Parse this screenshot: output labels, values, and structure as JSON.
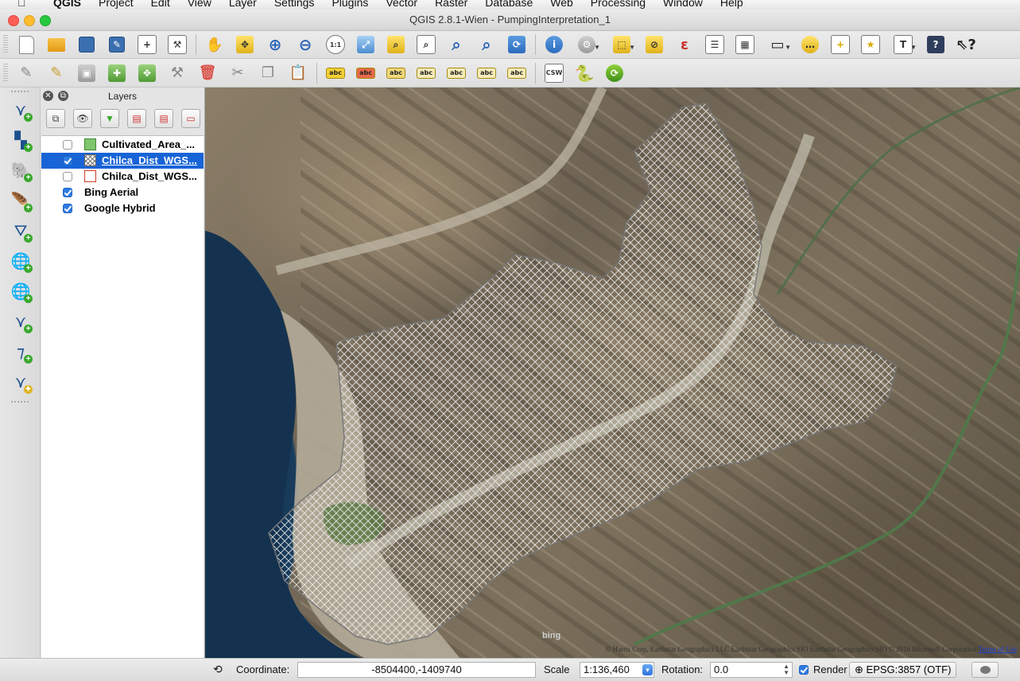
{
  "menubar": {
    "items": [
      "QGIS",
      "Project",
      "Edit",
      "View",
      "Layer",
      "Settings",
      "Plugins",
      "Vector",
      "Raster",
      "Database",
      "Web",
      "Processing",
      "Window",
      "Help"
    ]
  },
  "window": {
    "title": "QGIS 2.8.1-Wien - PumpingInterpretation_1"
  },
  "toolbar1": {
    "buttons": [
      {
        "name": "new-project-icon"
      },
      {
        "name": "open-project-icon"
      },
      {
        "name": "save-project-icon"
      },
      {
        "name": "save-as-icon"
      },
      {
        "name": "new-print-composer-icon"
      },
      {
        "name": "composer-manager-icon"
      },
      {
        "name": "pan-icon"
      },
      {
        "name": "pan-to-selection-icon"
      },
      {
        "name": "zoom-in-icon"
      },
      {
        "name": "zoom-out-icon"
      },
      {
        "name": "zoom-native-icon"
      },
      {
        "name": "zoom-full-icon"
      },
      {
        "name": "zoom-to-selection-icon"
      },
      {
        "name": "zoom-to-layer-icon"
      },
      {
        "name": "zoom-last-icon"
      },
      {
        "name": "zoom-next-icon"
      },
      {
        "name": "refresh-icon"
      },
      {
        "name": "identify-icon"
      },
      {
        "name": "run-action-icon"
      },
      {
        "name": "select-features-icon"
      },
      {
        "name": "deselect-icon"
      },
      {
        "name": "field-calculator-icon"
      },
      {
        "name": "select-by-expression-icon"
      },
      {
        "name": "attribute-table-icon"
      },
      {
        "name": "statistics-icon"
      },
      {
        "name": "measure-icon"
      },
      {
        "name": "map-tips-icon"
      },
      {
        "name": "new-bookmark-icon"
      },
      {
        "name": "show-bookmarks-icon"
      },
      {
        "name": "text-annotation-icon"
      },
      {
        "name": "help-icon"
      },
      {
        "name": "whats-this-icon"
      }
    ],
    "zoom_native_text": "1:1",
    "epsilon_text": "ε",
    "text_tool_text": "T"
  },
  "toolbar2": {
    "csw_text": "CSW",
    "label_text": "abc"
  },
  "layers_panel": {
    "title": "Layers",
    "layers": [
      {
        "name": "Cultivated_Area_...",
        "checked": false,
        "symbol": "green",
        "indent": true,
        "selected": false
      },
      {
        "name": "Chilca_Dist_WGS...",
        "checked": true,
        "symbol": "hatch",
        "indent": true,
        "selected": true
      },
      {
        "name": "Chilca_Dist_WGS...",
        "checked": false,
        "symbol": "outline",
        "indent": true,
        "selected": false
      },
      {
        "name": "Bing Aerial",
        "checked": true,
        "symbol": "none",
        "indent": false,
        "selected": false
      },
      {
        "name": "Google Hybrid",
        "checked": true,
        "symbol": "none",
        "indent": false,
        "selected": false
      }
    ]
  },
  "map": {
    "bing_logo": "bing",
    "attribution": "© Harris Corp, Earthstar Geographics LLC Earthstar Geographics SIO Earthstar Geographics SIO © 2016 Microsoft Corporation",
    "terms_link": "Terms of Use"
  },
  "statusbar": {
    "coordinate_label": "Coordinate:",
    "coordinate_value": "-8504400,-1409740",
    "scale_label": "Scale",
    "scale_value": "1:136,460",
    "rotation_label": "Rotation:",
    "rotation_value": "0.0",
    "render_label": "Render",
    "render_checked": true,
    "crs_label": "EPSG:3857 (OTF)"
  }
}
